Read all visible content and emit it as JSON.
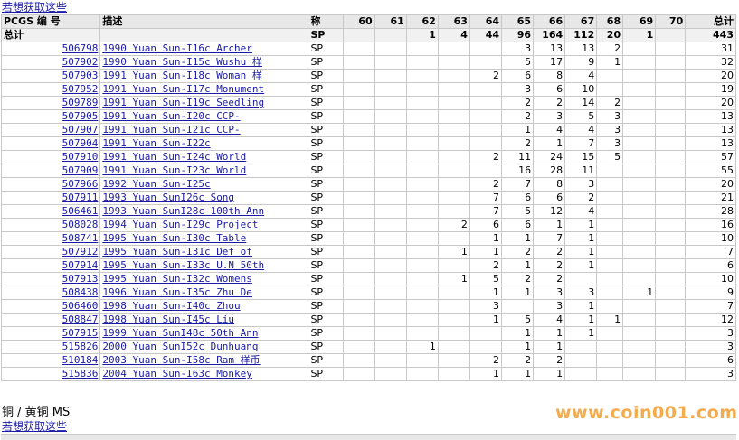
{
  "top_link": "若想获取这些",
  "table": {
    "headers": {
      "pcgs": "PCGS 编 号",
      "desc": "描述",
      "grade": "称",
      "grades": [
        "60",
        "61",
        "62",
        "63",
        "64",
        "65",
        "66",
        "67",
        "68",
        "69",
        "70"
      ],
      "total": "总计"
    },
    "total_row": {
      "label": "总计",
      "grade": "SP",
      "values": [
        "",
        "",
        "1",
        "4",
        "44",
        "96",
        "164",
        "112",
        "20",
        "1",
        ""
      ],
      "total": "443"
    },
    "rows": [
      {
        "pcgs": "506798",
        "desc": "1990 Yuan Sun-I16c Archer",
        "grade": "SP",
        "values": [
          "",
          "",
          "",
          "",
          "",
          "3",
          "13",
          "13",
          "2",
          "",
          ""
        ],
        "total": "31"
      },
      {
        "pcgs": "507902",
        "desc": "1990 Yuan Sun-I15c Wushu 样",
        "grade": "SP",
        "values": [
          "",
          "",
          "",
          "",
          "",
          "5",
          "17",
          "9",
          "1",
          "",
          ""
        ],
        "total": "32"
      },
      {
        "pcgs": "507903",
        "desc": "1991 Yuan Sun-I18c Woman 样",
        "grade": "SP",
        "values": [
          "",
          "",
          "",
          "",
          "2",
          "6",
          "8",
          "4",
          "",
          "",
          ""
        ],
        "total": "20"
      },
      {
        "pcgs": "507952",
        "desc": "1991 Yuan Sun-I17c Monument",
        "grade": "SP",
        "values": [
          "",
          "",
          "",
          "",
          "",
          "3",
          "6",
          "10",
          "",
          "",
          ""
        ],
        "total": "19"
      },
      {
        "pcgs": "509789",
        "desc": "1991 Yuan Sun-I19c Seedling",
        "grade": "SP",
        "values": [
          "",
          "",
          "",
          "",
          "",
          "2",
          "2",
          "14",
          "2",
          "",
          ""
        ],
        "total": "20"
      },
      {
        "pcgs": "507905",
        "desc": "1991 Yuan Sun-I20c CCP-",
        "grade": "SP",
        "values": [
          "",
          "",
          "",
          "",
          "",
          "2",
          "3",
          "5",
          "3",
          "",
          ""
        ],
        "total": "13"
      },
      {
        "pcgs": "507907",
        "desc": "1991 Yuan Sun-I21c CCP-",
        "grade": "SP",
        "values": [
          "",
          "",
          "",
          "",
          "",
          "1",
          "4",
          "4",
          "3",
          "",
          ""
        ],
        "total": "13"
      },
      {
        "pcgs": "507904",
        "desc": "1991 Yuan Sun-I22c",
        "grade": "SP",
        "values": [
          "",
          "",
          "",
          "",
          "",
          "2",
          "1",
          "7",
          "3",
          "",
          ""
        ],
        "total": "13"
      },
      {
        "pcgs": "507910",
        "desc": "1991 Yuan Sun-I24c World",
        "grade": "SP",
        "values": [
          "",
          "",
          "",
          "",
          "2",
          "11",
          "24",
          "15",
          "5",
          "",
          ""
        ],
        "total": "57"
      },
      {
        "pcgs": "507909",
        "desc": "1991 Yuan Sun-I23c World",
        "grade": "SP",
        "values": [
          "",
          "",
          "",
          "",
          "",
          "16",
          "28",
          "11",
          "",
          "",
          ""
        ],
        "total": "55"
      },
      {
        "pcgs": "507966",
        "desc": "1992 Yuan Sun-I25c",
        "grade": "SP",
        "values": [
          "",
          "",
          "",
          "",
          "2",
          "7",
          "8",
          "3",
          "",
          "",
          ""
        ],
        "total": "20"
      },
      {
        "pcgs": "507911",
        "desc": "1993 Yuan SunI26c Song",
        "grade": "SP",
        "values": [
          "",
          "",
          "",
          "",
          "7",
          "6",
          "6",
          "2",
          "",
          "",
          ""
        ],
        "total": "21"
      },
      {
        "pcgs": "506461",
        "desc": "1993 Yuan SunI28c 100th Ann",
        "grade": "SP",
        "values": [
          "",
          "",
          "",
          "",
          "7",
          "5",
          "12",
          "4",
          "",
          "",
          ""
        ],
        "total": "28"
      },
      {
        "pcgs": "508028",
        "desc": "1994 Yuan Sun-I29c Project",
        "grade": "SP",
        "values": [
          "",
          "",
          "",
          "2",
          "6",
          "6",
          "1",
          "1",
          "",
          "",
          ""
        ],
        "total": "16"
      },
      {
        "pcgs": "508741",
        "desc": "1995 Yuan Sun-I30c Table",
        "grade": "SP",
        "values": [
          "",
          "",
          "",
          "",
          "1",
          "1",
          "7",
          "1",
          "",
          "",
          ""
        ],
        "total": "10"
      },
      {
        "pcgs": "507912",
        "desc": "1995 Yuan Sun-I31c Def of",
        "grade": "SP",
        "values": [
          "",
          "",
          "",
          "1",
          "1",
          "2",
          "2",
          "1",
          "",
          "",
          ""
        ],
        "total": "7"
      },
      {
        "pcgs": "507914",
        "desc": "1995 Yuan Sun-I33c U.N 50th",
        "grade": "SP",
        "values": [
          "",
          "",
          "",
          "",
          "2",
          "1",
          "2",
          "1",
          "",
          "",
          ""
        ],
        "total": "6"
      },
      {
        "pcgs": "507913",
        "desc": "1995 Yuan Sun-I32c Womens",
        "grade": "SP",
        "values": [
          "",
          "",
          "",
          "1",
          "5",
          "2",
          "2",
          "",
          "",
          "",
          ""
        ],
        "total": "10"
      },
      {
        "pcgs": "508438",
        "desc": "1996 Yuan Sun-I35c Zhu De",
        "grade": "SP",
        "values": [
          "",
          "",
          "",
          "",
          "1",
          "1",
          "3",
          "3",
          "",
          "1",
          ""
        ],
        "total": "9"
      },
      {
        "pcgs": "506460",
        "desc": "1998 Yuan Sun-I40c Zhou",
        "grade": "SP",
        "values": [
          "",
          "",
          "",
          "",
          "3",
          "",
          "3",
          "1",
          "",
          "",
          ""
        ],
        "total": "7"
      },
      {
        "pcgs": "508847",
        "desc": "1998 Yuan Sun-I45c Liu",
        "grade": "SP",
        "values": [
          "",
          "",
          "",
          "",
          "1",
          "5",
          "4",
          "1",
          "1",
          "",
          ""
        ],
        "total": "12"
      },
      {
        "pcgs": "507915",
        "desc": "1999 Yuan SunI48c 50th Ann",
        "grade": "SP",
        "values": [
          "",
          "",
          "",
          "",
          "",
          "1",
          "1",
          "1",
          "",
          "",
          ""
        ],
        "total": "3"
      },
      {
        "pcgs": "515826",
        "desc": "2000 Yuan SunI52c Dunhuang",
        "grade": "SP",
        "values": [
          "",
          "",
          "1",
          "",
          "",
          "1",
          "1",
          "",
          "",
          "",
          ""
        ],
        "total": "3"
      },
      {
        "pcgs": "510184",
        "desc": "2003 Yuan Sun-I58c Ram 样币",
        "grade": "SP",
        "values": [
          "",
          "",
          "",
          "",
          "2",
          "2",
          "2",
          "",
          "",
          "",
          ""
        ],
        "total": "6"
      },
      {
        "pcgs": "515836",
        "desc": "2004 Yuan Sun-I63c Monkey",
        "grade": "SP",
        "values": [
          "",
          "",
          "",
          "",
          "1",
          "1",
          "1",
          "",
          "",
          "",
          ""
        ],
        "total": "3"
      }
    ]
  },
  "section_title": "铜 / 黄铜 MS",
  "section_link": "若想获取这些",
  "watermark": "www.coin001.com",
  "colors": {
    "link": "#1a1aa6",
    "header_bg": "#e8e8e8",
    "watermark": "#f2a33a"
  }
}
